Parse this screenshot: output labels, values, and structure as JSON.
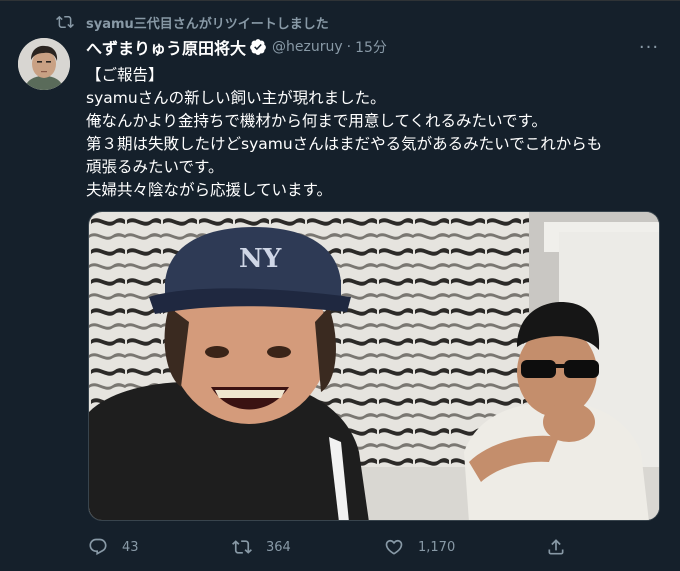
{
  "retweet_context": {
    "label": "syamu三代目さんがリツイートしました",
    "icon": "retweet-icon"
  },
  "tweet": {
    "author_name": "へずまりゅう原田将大",
    "verified": true,
    "handle": "@hezuruy",
    "separator": "·",
    "time": "15分",
    "more_label": "···",
    "lines": [
      "【ご報告】",
      "syamuさんの新しい飼い主が現れました。",
      "俺なんかより金持ちで機材から何まで用意してくれるみたいです。",
      "第３期は失敗したけどsyamuさんはまだやる気があるみたいでこれからも",
      "頑張るみたいです。",
      "夫婦共々陰ながら応援しています。"
    ]
  },
  "actions": {
    "reply": {
      "icon": "reply-icon",
      "count": "43"
    },
    "retweet": {
      "icon": "retweet-icon",
      "count": "364"
    },
    "like": {
      "icon": "heart-icon",
      "count": "1,170"
    },
    "share": {
      "icon": "share-icon"
    }
  },
  "colors": {
    "background": "#15202b",
    "text_primary": "#ffffff",
    "text_secondary": "#8899a6",
    "verified": "#ffffff"
  }
}
